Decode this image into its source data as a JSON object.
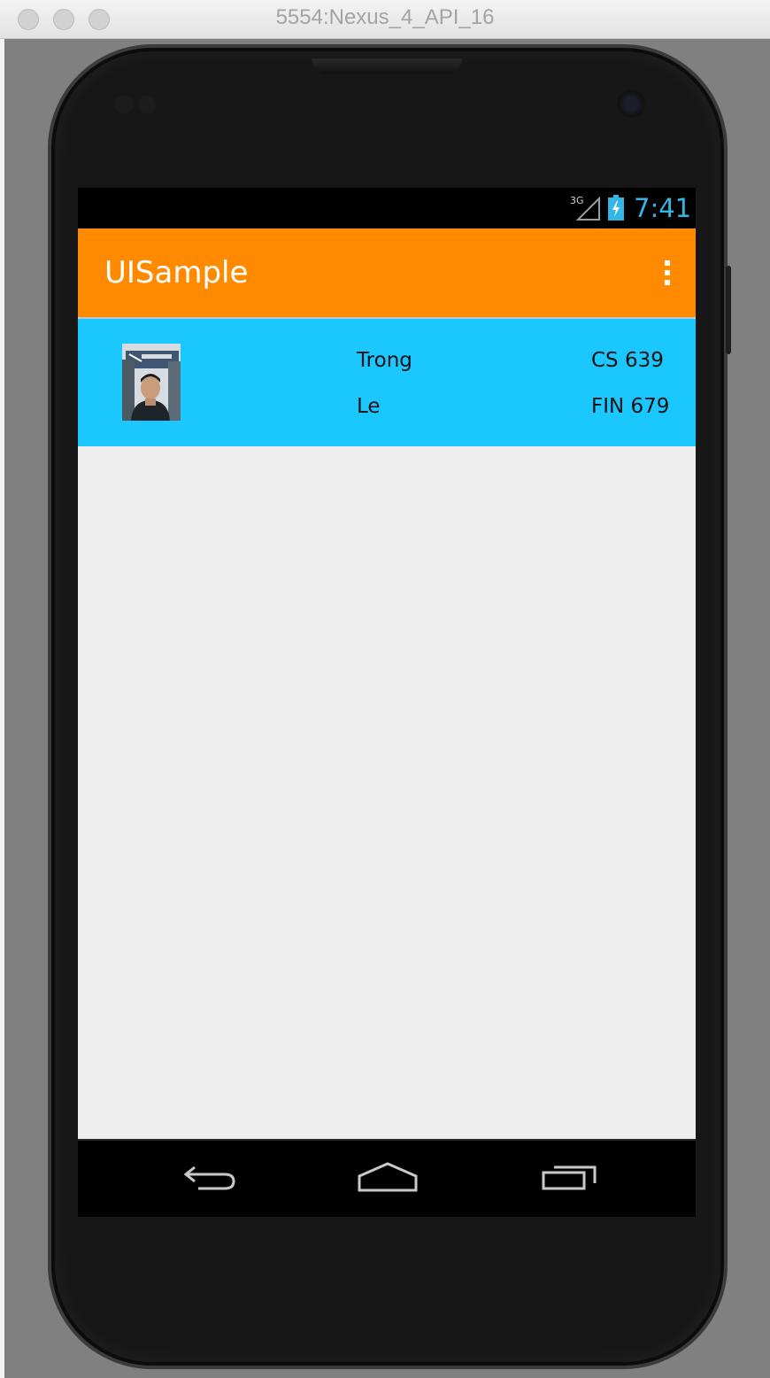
{
  "window": {
    "title": "5554:Nexus_4_API_16",
    "background_color": "#808080"
  },
  "status_bar": {
    "network_label": "3G",
    "time": "7:41",
    "time_color": "#33b5e5"
  },
  "action_bar": {
    "title": "UISample",
    "background_color": "#ff8a00",
    "overflow_icon": "more-vert-icon"
  },
  "list": {
    "background_color": "#1ac8ff",
    "items": [
      {
        "first_name": "Trong",
        "last_name": "Le",
        "course_1": "CS 639",
        "course_2": "FIN 679",
        "photo": "profile-photo"
      }
    ]
  },
  "nav_bar": {
    "back_icon": "back-icon",
    "home_icon": "home-icon",
    "recents_icon": "recent-apps-icon"
  }
}
